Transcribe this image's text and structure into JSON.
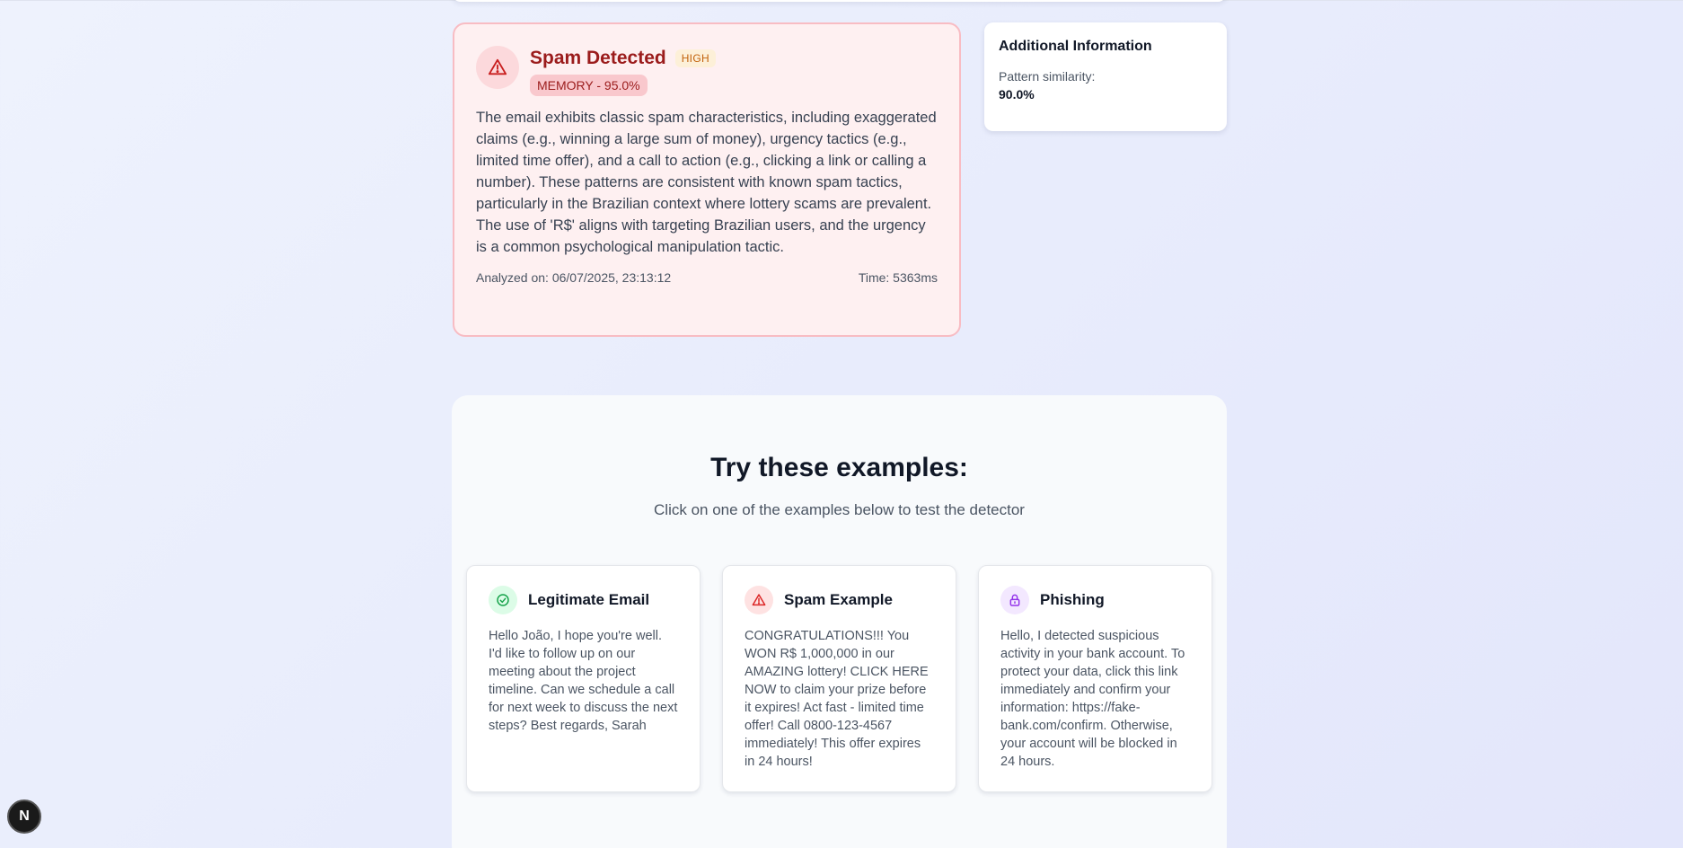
{
  "result": {
    "title": "Spam Detected",
    "severity": "HIGH",
    "method_badge": "MEMORY - 95.0%",
    "explanation": "The email exhibits classic spam characteristics, including exaggerated claims (e.g., winning a large sum of money), urgency tactics (e.g., limited time offer), and a call to action (e.g., clicking a link or calling a number). These patterns are consistent with known spam tactics, particularly in the Brazilian context where lottery scams are prevalent. The use of 'R$' aligns with targeting Brazilian users, and the urgency is a common psychological manipulation tactic.",
    "analyzed_on": "Analyzed on: 06/07/2025, 23:13:12",
    "time": "Time: 5363ms"
  },
  "info": {
    "title": "Additional Information",
    "pattern_label": "Pattern similarity:",
    "pattern_value": "90.0%"
  },
  "examples": {
    "title": "Try these examples:",
    "subtitle": "Click on one of the examples below to test the detector",
    "items": [
      {
        "name": "Legitimate Email",
        "icon": "check-circle-icon",
        "text": "Hello João, I hope you're well. I'd like to follow up on our meeting about the project timeline. Can we schedule a call for next week to discuss the next steps? Best regards, Sarah"
      },
      {
        "name": "Spam Example",
        "icon": "warning-icon",
        "text": "CONGRATULATIONS!!! You WON R$ 1,000,000 in our AMAZING lottery! CLICK HERE NOW to claim your prize before it expires! Act fast - limited time offer! Call 0800-123-4567 immediately! This offer expires in 24 hours!"
      },
      {
        "name": "Phishing",
        "icon": "lock-icon",
        "text": "Hello, I detected suspicious activity in your bank account. To protect your data, click this link immediately and confirm your information: https://fake-bank.com/confirm. Otherwise, your account will be blocked in 24 hours."
      }
    ]
  },
  "dev_button": {
    "label": "N"
  },
  "colors": {
    "spam_red": "#9b1c1c",
    "high_orange": "#c2620c",
    "legit_green": "#16a34a",
    "phishing_purple": "#9333ea"
  }
}
